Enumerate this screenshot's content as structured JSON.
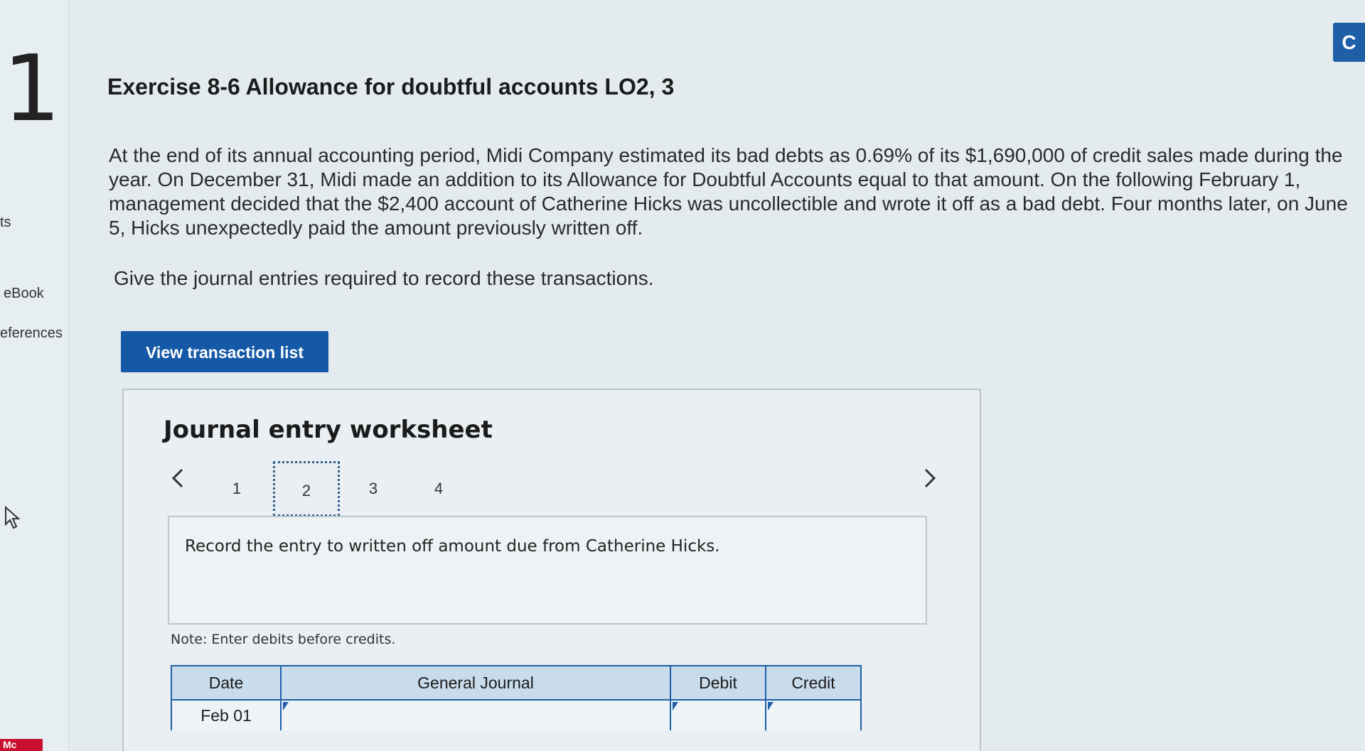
{
  "sidebar": {
    "question_number": "1",
    "points_label": "ts",
    "ebook_label": "eBook",
    "references_label": "eferences",
    "logo_text": "Mc"
  },
  "top_right_button": "C",
  "exercise": {
    "title": "Exercise 8-6 Allowance for doubtful accounts LO2, 3",
    "problem": "At the end of its annual accounting period, Midi Company estimated its bad debts as 0.69% of its $1,690,000 of credit sales made during the year. On December 31, Midi made an addition to its Allowance for Doubtful Accounts equal to that amount. On the following February 1, management decided that the $2,400 account of Catherine Hicks was uncollectible and wrote it off as a bad debt. Four months later, on June 5, Hicks unexpectedly paid the amount previously written off.",
    "instruction": "Give the journal entries required to record these transactions.",
    "view_button": "View transaction list"
  },
  "worksheet": {
    "title": "Journal entry worksheet",
    "steps": [
      "1",
      "2",
      "3",
      "4"
    ],
    "active_step": "2",
    "prompt": "Record the entry to written off amount due from Catherine Hicks.",
    "note": "Note: Enter debits before credits.",
    "table": {
      "headers": {
        "date": "Date",
        "general_journal": "General Journal",
        "debit": "Debit",
        "credit": "Credit"
      },
      "rows": [
        {
          "date": "Feb 01",
          "account": "",
          "debit": "",
          "credit": ""
        }
      ]
    }
  },
  "colors": {
    "accent": "#1559a6",
    "header_bg": "#c9dcec",
    "page_bg": "#e4ebee"
  }
}
